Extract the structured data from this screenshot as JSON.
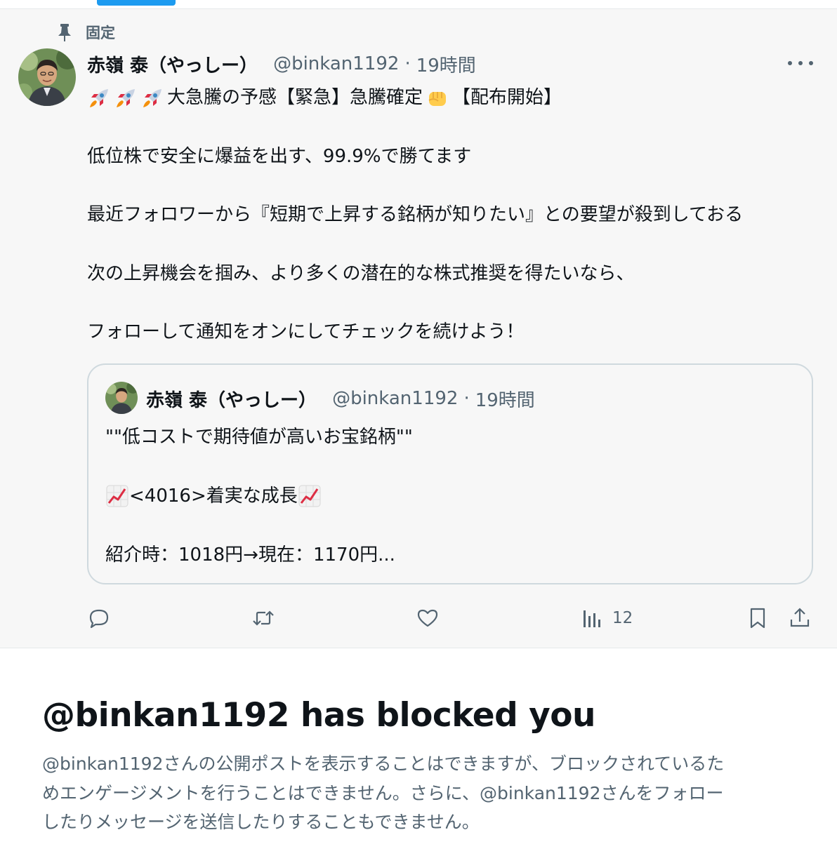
{
  "pinned": {
    "label": "固定"
  },
  "post": {
    "author": {
      "name": "赤嶺 泰（やっしー）",
      "handle": "@binkan1192"
    },
    "separator": "·",
    "time": "19時間",
    "title_text_1": "大急騰の予感【緊急】急騰確定",
    "title_text_2": "【配布開始】",
    "lines": [
      "低位株で安全に爆益を出す、99.9%で勝てます",
      "最近フォロワーから『短期で上昇する銘柄が知りたい』との要望が殺到しておる",
      "次の上昇機会を掴み、より多くの潜在的な株式推奨を得たいなら、",
      "フォローして通知をオンにしてチェックを続けよう！"
    ]
  },
  "quote": {
    "author": {
      "name": "赤嶺 泰（やっしー）",
      "handle": "@binkan1192"
    },
    "separator": "·",
    "time": "19時間",
    "line1": "\"\"低コストで期待値が高いお宝銘柄\"\"",
    "line2": " <4016>着実な成長",
    "line3": "紹介時：1018円→現在：1170円..."
  },
  "actions": {
    "views": "12"
  },
  "blocked": {
    "title": "@binkan1192 has blocked you",
    "desc": [
      "@binkan1192さんの公開ポストを表示することはできますが、ブロックされているた",
      "めエンゲージメントを行うことはできません。さらに、@binkan1192さんをフォロー",
      "したりメッセージを送信したりすることもできません。"
    ]
  },
  "colors": {
    "accent": "#1d9bf0",
    "text": "#0f1419",
    "secondary": "#536471",
    "border": "#cfd9de",
    "tweet_bg": "#f7f7f7"
  },
  "icons": [
    "pin-icon",
    "more-icon",
    "rocket-emoji",
    "fist-emoji",
    "chart-increasing-emoji",
    "reply-icon",
    "retweet-icon",
    "like-icon",
    "views-icon",
    "bookmark-icon",
    "share-icon"
  ]
}
